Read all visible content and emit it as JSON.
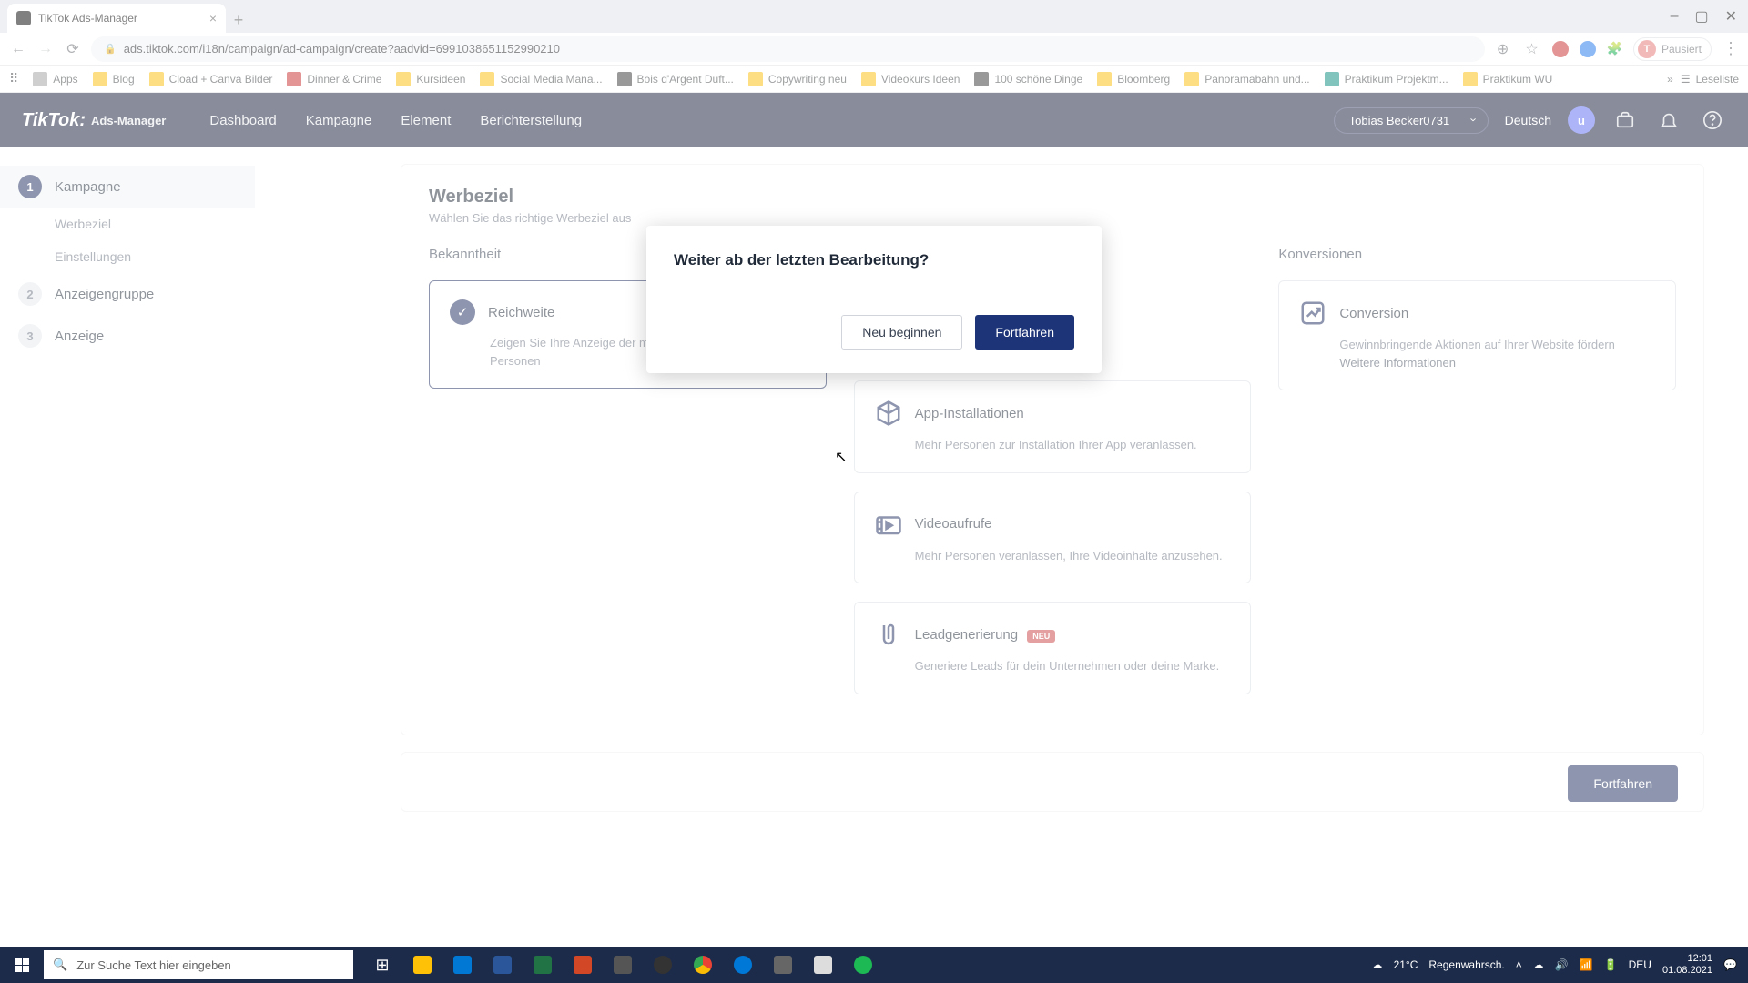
{
  "browser": {
    "tab_title": "TikTok Ads-Manager",
    "url": "ads.tiktok.com/i18n/campaign/ad-campaign/create?aadvid=6991038651152990210",
    "profile_status": "Pausiert",
    "profile_initial": "T",
    "reading_list": "Leseliste"
  },
  "bookmarks": [
    "Apps",
    "Blog",
    "Cload + Canva Bilder",
    "Dinner & Crime",
    "Kursideen",
    "Social Media Mana...",
    "Bois d'Argent Duft...",
    "Copywriting neu",
    "Videokurs Ideen",
    "100 schöne Dinge",
    "Bloomberg",
    "Panoramabahn und...",
    "Praktikum Projektm...",
    "Praktikum WU"
  ],
  "header": {
    "logo_main": "TikTok:",
    "logo_sub": "Ads-Manager",
    "nav": [
      "Dashboard",
      "Kampagne",
      "Element",
      "Berichterstellung"
    ],
    "account": "Tobias Becker0731",
    "language": "Deutsch",
    "avatar_initial": "u"
  },
  "sidebar": {
    "steps": [
      {
        "num": "1",
        "label": "Kampagne",
        "active": true
      },
      {
        "num": "2",
        "label": "Anzeigengruppe",
        "active": false
      },
      {
        "num": "3",
        "label": "Anzeige",
        "active": false
      }
    ],
    "substeps": [
      "Werbeziel",
      "Einstellungen"
    ]
  },
  "page": {
    "title": "Werbeziel",
    "subtitle": "Wählen Sie das richtige Werbeziel aus",
    "continue": "Fortfahren",
    "columns": {
      "awareness": {
        "title": "Bekanntheit",
        "cards": [
          {
            "icon": "check",
            "title": "Reichweite",
            "desc": "Zeigen Sie Ihre Anzeige der maximalen Anzahl von Personen"
          }
        ]
      },
      "consideration": {
        "title": "",
        "cards": [
          {
            "icon": "box",
            "title": "App-Installationen",
            "desc": "Mehr Personen zur Installation Ihrer App veranlassen."
          },
          {
            "icon": "video",
            "title": "Videoaufrufe",
            "desc": "Mehr Personen veranlassen, Ihre Videoinhalte anzusehen."
          },
          {
            "icon": "lead",
            "title": "Leadgenerierung",
            "desc": "Generiere Leads für dein Unternehmen oder deine Marke.",
            "badge": "NEU"
          }
        ]
      },
      "conversion": {
        "title": "Konversionen",
        "cards": [
          {
            "icon": "conversion",
            "title": "Conversion",
            "desc": "Gewinnbringende Aktionen auf Ihrer Website fördern",
            "link": "Weitere Informationen"
          }
        ]
      }
    }
  },
  "modal": {
    "title": "Weiter ab der letzten Bearbeitung?",
    "secondary": "Neu beginnen",
    "primary": "Fortfahren"
  },
  "taskbar": {
    "search_placeholder": "Zur Suche Text hier eingeben",
    "weather_temp": "21°C",
    "weather_desc": "Regenwahrsch.",
    "lang": "DEU",
    "time": "12:01",
    "date": "01.08.2021"
  }
}
